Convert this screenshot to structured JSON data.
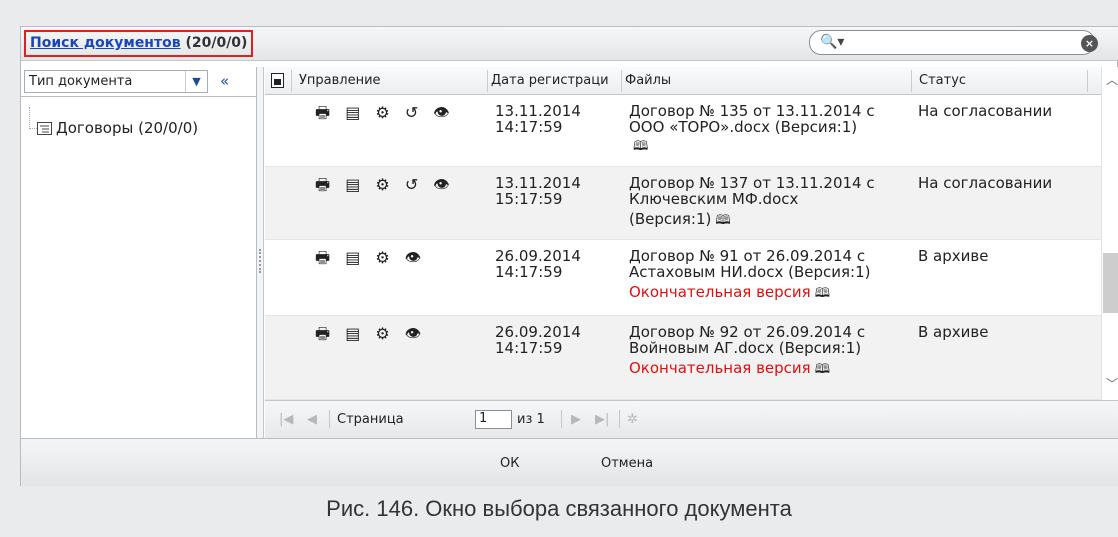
{
  "title": {
    "link": "Поиск документов",
    "count": "(20/0/0)"
  },
  "search": {
    "icon": "search-icon",
    "clear_icon": "clear-icon"
  },
  "left_panel": {
    "doc_type": "Тип документа",
    "collapse": "«",
    "tree_item": "Договоры (20/0/0)"
  },
  "grid": {
    "headers": [
      "Управление",
      "Дата регистраци",
      "Файлы",
      "Статус"
    ],
    "rows": [
      {
        "date1": "13.11.2014",
        "date2": "14:17:59",
        "file1": "Договор № 135 от 13.11.2014 с",
        "file2": "ООО «ТОРО».docx (Версия:1)",
        "file3": "",
        "final": "",
        "status": "На согласовании",
        "actions": "🖶 ▤ ⚙ ↺ 👁"
      },
      {
        "date1": "13.11.2014",
        "date2": "15:17:59",
        "file1": "Договор № 137 от 13.11.2014 с",
        "file2": "Ключевским МФ.docx",
        "file3": "(Версия:1)",
        "final": "",
        "status": "На согласовании",
        "actions": "🖶 ▤ ⚙ ↺ 👁"
      },
      {
        "date1": "26.09.2014",
        "date2": "14:17:59",
        "file1": "Договор № 91 от 26.09.2014 с",
        "file2": "Астаховым НИ.docx (Версия:1)",
        "file3": "",
        "final": "Окончательная версия",
        "status": "В архиве",
        "actions": "🖶 ▤ ⚙ 👁"
      },
      {
        "date1": "26.09.2014",
        "date2": "14:17:59",
        "file1": "Договор № 92 от 26.09.2014 с",
        "file2": "Войновым АГ.docx (Версия:1)",
        "file3": "",
        "final": "Окончательная версия",
        "status": "В архиве",
        "actions": "🖶 ▤ ⚙ 👁"
      }
    ]
  },
  "pager": {
    "page_label": "Страница",
    "page_value": "1",
    "of_label": "из 1"
  },
  "footer": {
    "ok": "ОК",
    "cancel": "Отмена"
  },
  "caption": "Рис. 146. Окно выбора связанного документа",
  "colors": {
    "link": "#1a47b8",
    "highlight_border": "#e02020",
    "final_version": "#e01010"
  }
}
